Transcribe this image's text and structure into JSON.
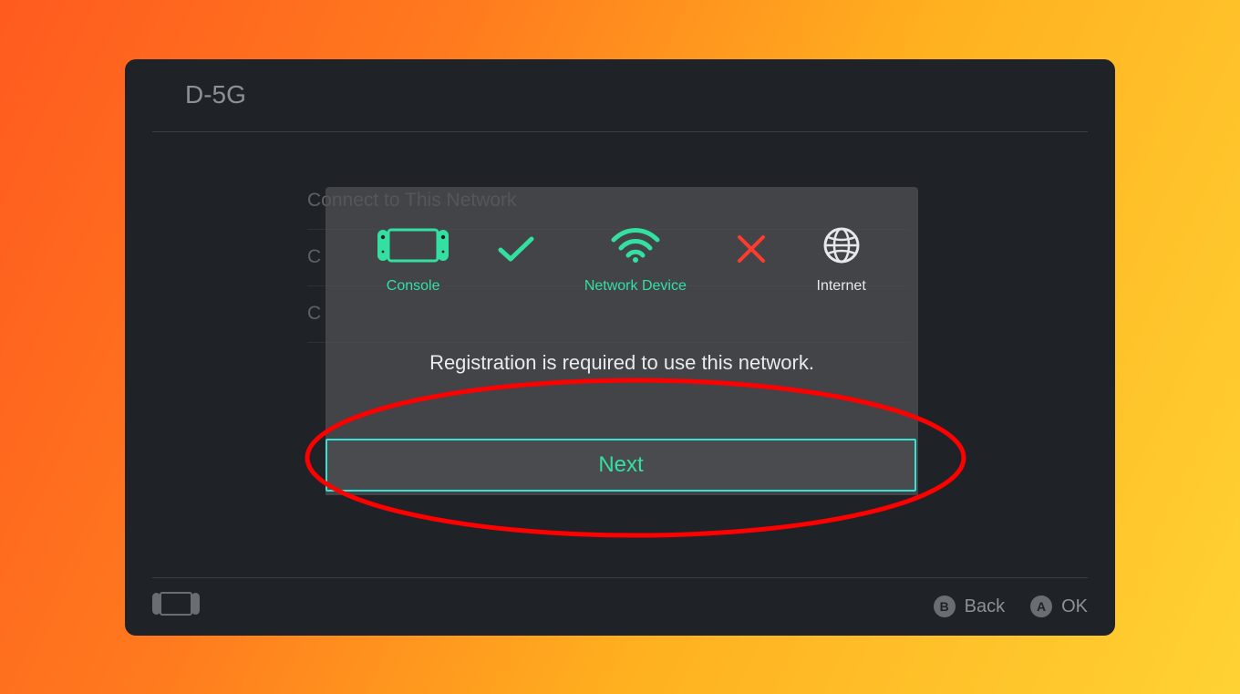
{
  "header": {
    "title": "D-5G"
  },
  "background_menu": {
    "items": [
      "Connect to This Network",
      "C",
      "C"
    ]
  },
  "dialog": {
    "status": {
      "console_label": "Console",
      "network_device_label": "Network Device",
      "internet_label": "Internet",
      "console_to_device": "connected",
      "device_to_internet": "failed"
    },
    "message": "Registration is required to use this network.",
    "next_label": "Next"
  },
  "footer": {
    "back_label": "Back",
    "ok_label": "OK",
    "back_button_glyph": "B",
    "ok_button_glyph": "A"
  },
  "colors": {
    "accent": "#34e0a1",
    "error": "#ff3b30",
    "annotation": "#ff0000",
    "panel_bg": "#1f2227"
  }
}
